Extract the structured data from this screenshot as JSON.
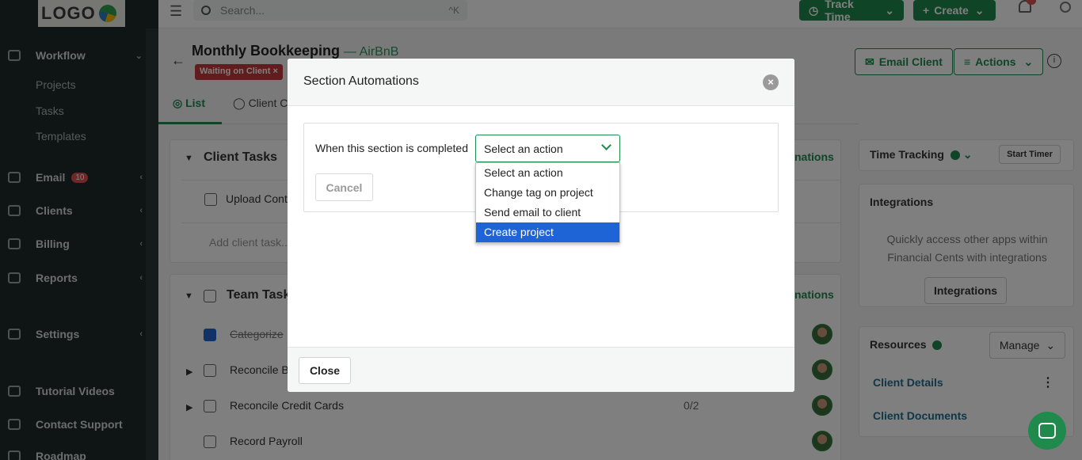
{
  "sidebar": {
    "logo_text": "LOGO",
    "items": [
      {
        "label": "Workflow",
        "icon": "briefcase-icon"
      },
      {
        "label": "Email",
        "icon": "mail-icon",
        "badge": "10"
      },
      {
        "label": "Clients",
        "icon": "users-icon"
      },
      {
        "label": "Billing",
        "icon": "credit-card-icon"
      },
      {
        "label": "Reports",
        "icon": "file-icon"
      },
      {
        "label": "Settings",
        "icon": "gear-icon"
      },
      {
        "label": "Tutorial Videos",
        "icon": "video-icon"
      },
      {
        "label": "Contact Support",
        "icon": "chat-icon"
      },
      {
        "label": "Roadmap",
        "icon": "map-icon"
      }
    ],
    "sub_items": [
      "Projects",
      "Tasks",
      "Templates"
    ]
  },
  "topbar": {
    "search_placeholder": "Search...",
    "search_shortcut": "^K",
    "track_time_label": "Track Time",
    "create_label": "Create"
  },
  "page": {
    "title": "Monthly Bookkeeping",
    "client": "— AirBnB",
    "status_badge": "Waiting on Client",
    "tabs": [
      "List",
      "Client C"
    ],
    "email_client_label": "Email Client",
    "actions_label": "Actions"
  },
  "sections": {
    "client_tasks": {
      "title": "Client Tasks",
      "rows": [
        "Upload Contr"
      ],
      "add_placeholder": "Add client task..."
    },
    "team_tasks": {
      "title": "Team Task",
      "rows": [
        "Categorize",
        "Reconcile B",
        "Reconcile Credit Cards",
        "Record Payroll"
      ],
      "progress": "0/2"
    },
    "automations_link": "nations"
  },
  "right_panel": {
    "time_tracking": "Time Tracking",
    "start_timer": "Start Timer",
    "integrations_title": "Integrations",
    "integrations_text_1": "Quickly access other apps within",
    "integrations_text_2": "Financial Cents with integrations",
    "integrations_button": "Integrations",
    "resources_title": "Resources",
    "manage_label": "Manage",
    "links": [
      "Client Details",
      "Client Documents"
    ]
  },
  "modal": {
    "title": "Section Automations",
    "when_label": "When this section is completed",
    "select_value": "Select an action",
    "cancel_label": "Cancel",
    "close_label": "Close",
    "options": [
      "Select an action",
      "Change tag on project",
      "Send email to client",
      "Create project"
    ],
    "highlighted_option": "Create project"
  },
  "colors": {
    "brand_green": "#1f8a4c",
    "highlight_blue": "#1e64d6",
    "sidebar_bg": "#1f2a2b"
  }
}
